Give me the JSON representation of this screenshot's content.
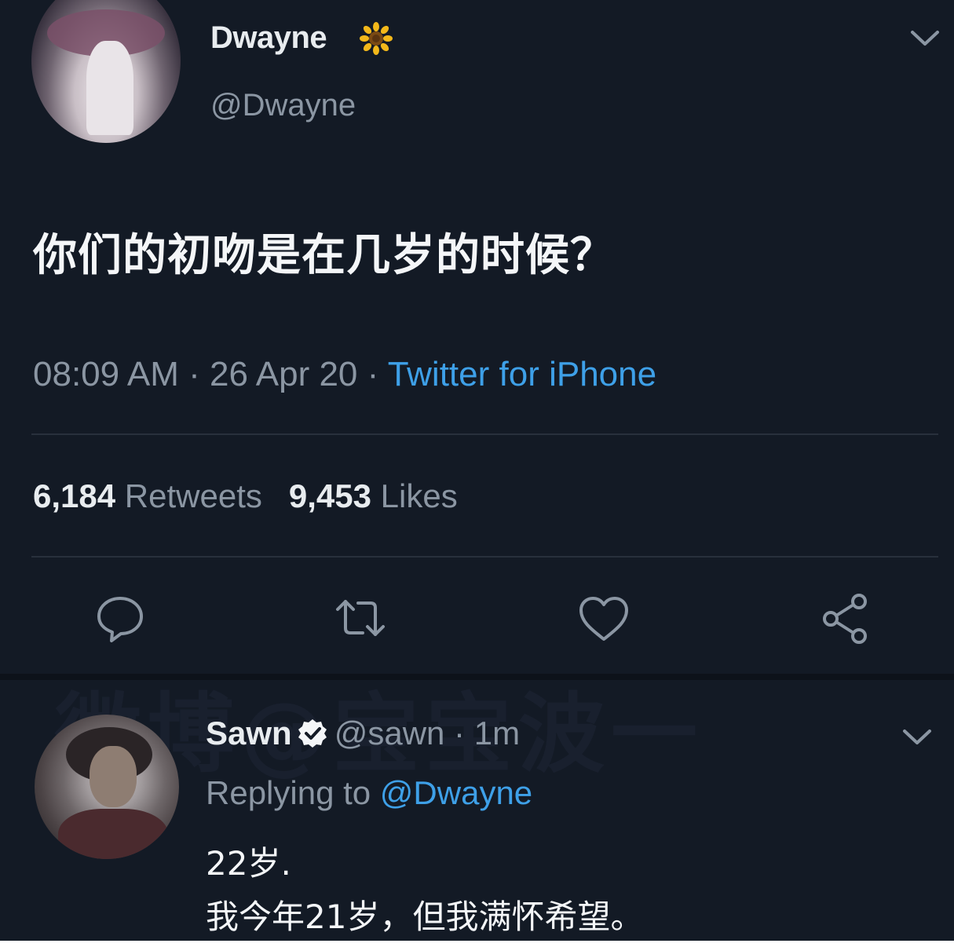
{
  "tweet": {
    "author_name": "Dwayne",
    "author_name_emoji": "sunflower-icon",
    "author_handle": "@Dwayne",
    "text": "你们的初吻是在几岁的时候？",
    "time": "08:09 AM",
    "sep1": " · ",
    "date": "26 Apr 20",
    "sep2": " · ",
    "source": "Twitter for iPhone",
    "retweets_count": "6,184",
    "retweets_label": "Retweets",
    "likes_count": "9,453",
    "likes_label": "Likes",
    "actions": [
      "reply-icon",
      "retweet-icon",
      "like-icon",
      "share-icon"
    ]
  },
  "watermark": "微博@宝宝波一",
  "reply": {
    "author_name": "Sawn",
    "verified_icon": "verified-badge-icon",
    "author_handle": "@sawn",
    "sep": " · ",
    "time": "1m",
    "replying_prefix": "Replying to",
    "replying_to": "@Dwayne",
    "line1": "22岁.",
    "line2": "我今年21岁，但我满怀希望。"
  },
  "colors": {
    "background": "#131a25",
    "text_primary": "#e8ecef",
    "text_secondary": "#8b96a3",
    "link_blue": "#3ea0e8",
    "verified": "#ffffff"
  }
}
